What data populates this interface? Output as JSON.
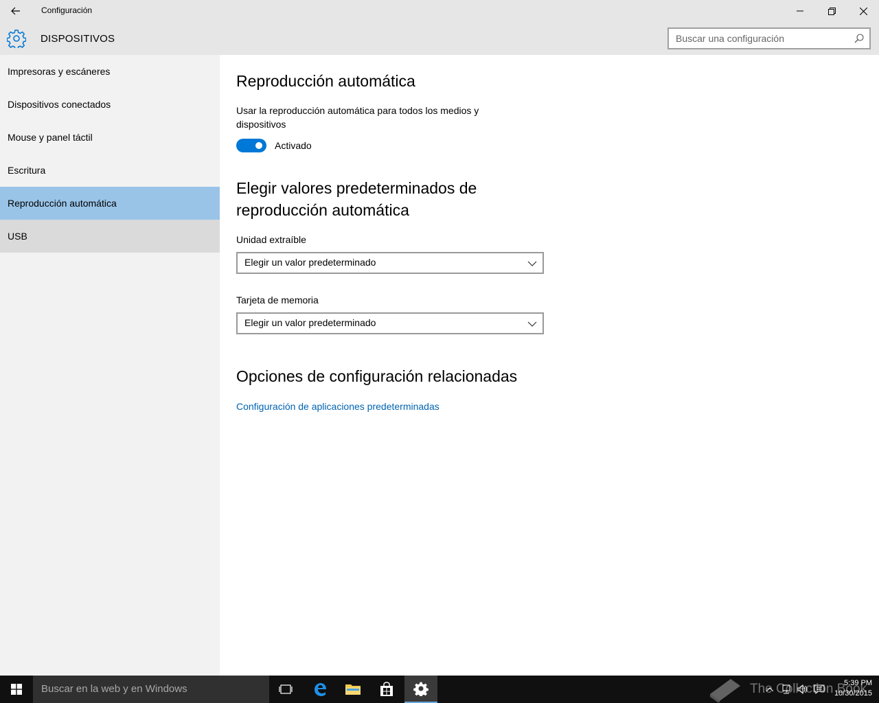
{
  "window": {
    "title": "Configuración"
  },
  "header": {
    "section_title": "DISPOSITIVOS",
    "search_placeholder": "Buscar una configuración"
  },
  "sidebar": {
    "items": [
      {
        "label": "Impresoras y escáneres"
      },
      {
        "label": "Dispositivos conectados"
      },
      {
        "label": "Mouse y panel táctil"
      },
      {
        "label": "Escritura"
      },
      {
        "label": "Reproducción automática",
        "selected": true
      },
      {
        "label": "USB"
      }
    ]
  },
  "main": {
    "autoplay_title": "Reproducción automática",
    "autoplay_desc": "Usar la reproducción automática para todos los medios y dispositivos",
    "toggle_label": "Activado",
    "toggle_on": true,
    "defaults_title_line1": "Elegir valores predeterminados de",
    "defaults_title_line2": "reproducción automática",
    "removable_label": "Unidad extraíble",
    "removable_value": "Elegir un valor predeterminado",
    "memory_label": "Tarjeta de memoria",
    "memory_value": "Elegir un valor predeterminado",
    "related_title": "Opciones de configuración relacionadas",
    "related_link": "Configuración de aplicaciones predeterminadas"
  },
  "taskbar": {
    "search_placeholder": "Buscar en la web y en Windows",
    "time": "5:39 PM",
    "date": "10/30/2015",
    "watermark": "The Collection Book"
  },
  "colors": {
    "accent": "#0078d7",
    "selected_nav": "#99c4e8",
    "link": "#0063b1"
  }
}
